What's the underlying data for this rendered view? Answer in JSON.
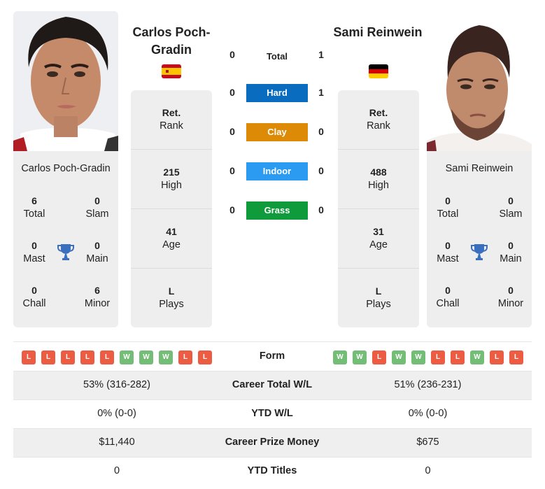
{
  "player1": {
    "name": "Carlos Poch-Gradin",
    "header_name": "Carlos Poch-Gradin",
    "flag": "spain-flag",
    "titles": {
      "total": {
        "value": "6",
        "label": "Total"
      },
      "slam": {
        "value": "0",
        "label": "Slam"
      },
      "mast": {
        "value": "0",
        "label": "Mast"
      },
      "main": {
        "value": "0",
        "label": "Main"
      },
      "chall": {
        "value": "0",
        "label": "Chall"
      },
      "minor": {
        "value": "6",
        "label": "Minor"
      }
    },
    "stats": [
      {
        "value": "Ret.",
        "label": "Rank"
      },
      {
        "value": "215",
        "label": "High"
      },
      {
        "value": "41",
        "label": "Age"
      },
      {
        "value": "L",
        "label": "Plays"
      }
    ],
    "form": [
      "L",
      "L",
      "L",
      "L",
      "L",
      "W",
      "W",
      "W",
      "L",
      "L"
    ]
  },
  "player2": {
    "name": "Sami Reinwein",
    "header_name": "Sami Reinwein",
    "flag": "germany-flag",
    "titles": {
      "total": {
        "value": "0",
        "label": "Total"
      },
      "slam": {
        "value": "0",
        "label": "Slam"
      },
      "mast": {
        "value": "0",
        "label": "Mast"
      },
      "main": {
        "value": "0",
        "label": "Main"
      },
      "chall": {
        "value": "0",
        "label": "Chall"
      },
      "minor": {
        "value": "0",
        "label": "Minor"
      }
    },
    "stats": [
      {
        "value": "Ret.",
        "label": "Rank"
      },
      {
        "value": "488",
        "label": "High"
      },
      {
        "value": "31",
        "label": "Age"
      },
      {
        "value": "L",
        "label": "Plays"
      }
    ],
    "form": [
      "W",
      "W",
      "L",
      "W",
      "W",
      "L",
      "L",
      "W",
      "L",
      "L"
    ]
  },
  "h2h": [
    {
      "label": "Total",
      "left": "0",
      "right": "1",
      "color": ""
    },
    {
      "label": "Hard",
      "left": "0",
      "right": "1",
      "color": "#0a6cbf"
    },
    {
      "label": "Clay",
      "left": "0",
      "right": "0",
      "color": "#dd8a06"
    },
    {
      "label": "Indoor",
      "left": "0",
      "right": "0",
      "color": "#2b9bf2"
    },
    {
      "label": "Grass",
      "left": "0",
      "right": "0",
      "color": "#0f9a3c"
    }
  ],
  "form_label": "Form",
  "comparison": [
    {
      "label": "Career Total W/L",
      "left": "53% (316-282)",
      "right": "51% (236-231)"
    },
    {
      "label": "YTD W/L",
      "left": "0% (0-0)",
      "right": "0% (0-0)"
    },
    {
      "label": "Career Prize Money",
      "left": "$11,440",
      "right": "$675"
    },
    {
      "label": "YTD Titles",
      "left": "0",
      "right": "0"
    }
  ],
  "colors": {
    "loss": "#ec5c43",
    "win": "#74bd77",
    "trophy": "#3a6fbf",
    "card_bg": "#eeeeee"
  }
}
